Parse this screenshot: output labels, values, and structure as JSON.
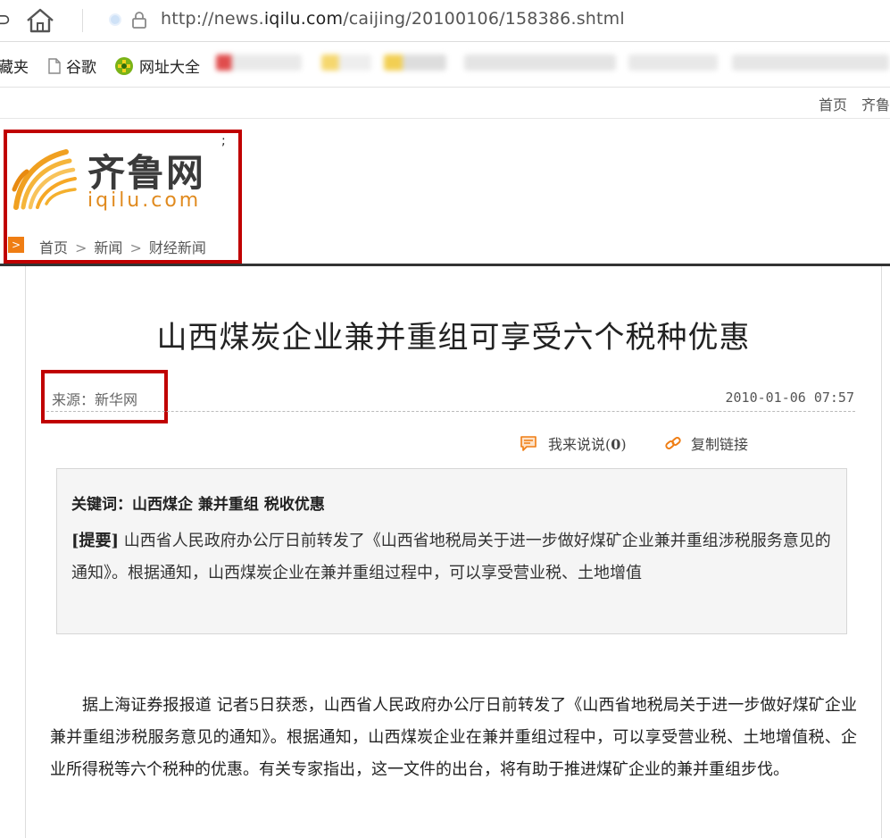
{
  "browser": {
    "nav_fragment": "⊃",
    "url_prefix": "http://news.",
    "url_host": "iqilu.com",
    "url_path": "/caijing/20100106/158386.shtml"
  },
  "bookmarks": {
    "items": [
      {
        "label": "藏夹"
      },
      {
        "label": "谷歌"
      },
      {
        "label": "网址大全"
      }
    ]
  },
  "site": {
    "top_links": [
      "首页",
      "齐鲁"
    ],
    "logo_text": "齐鲁网",
    "logo_domain": "iqilu.com",
    "logo_tick": ";",
    "breadcrumb": [
      "首页",
      "新闻",
      "财经新闻"
    ]
  },
  "article": {
    "title": "山西煤炭企业兼并重组可享受六个税种优惠",
    "source": "来源：新华网",
    "date": "2010-01-06 07:57",
    "comment_label": "我来说说(",
    "comment_count": "0",
    "comment_close": ")",
    "copy_label": "复制链接",
    "keywords": "关键词：山西煤企 兼并重组 税收优惠",
    "summary_label": "[提要]",
    "summary": "山西省人民政府办公厅日前转发了《山西省地税局关于进一步做好煤矿企业兼并重组涉税服务意见的通知》。根据通知，山西煤炭企业在兼并重组过程中，可以享受营业税、土地增值",
    "body": "据上海证券报报道 记者5日获悉，山西省人民政府办公厅日前转发了《山西省地税局关于进一步做好煤矿企业兼并重组涉税服务意见的通知》。根据通知，山西煤炭企业在兼并重组过程中，可以享受营业税、土地增值税、企业所得税等六个税种的优惠。有关专家指出，这一文件的出台，将有助于推进煤矿企业的兼并重组步伐。"
  },
  "colors": {
    "highlight_box": "#c00000",
    "brand_orange": "#ef7d13"
  }
}
